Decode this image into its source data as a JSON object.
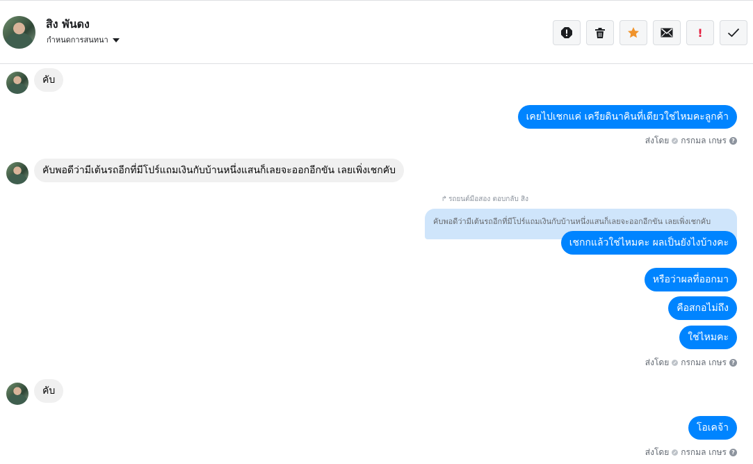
{
  "header": {
    "contact_name": "สิง พันดง",
    "subtitle": "กำหนดการสนทนา",
    "tools": [
      {
        "icon": "alert-circle-icon"
      },
      {
        "icon": "trash-icon"
      },
      {
        "icon": "star-icon",
        "color": "#f0932b"
      },
      {
        "icon": "envelope-icon"
      },
      {
        "icon": "exclamation-icon",
        "label": "!",
        "color": "#e41e3f"
      },
      {
        "icon": "check-icon"
      }
    ]
  },
  "messages": [
    {
      "side": "in",
      "text": "คับ"
    },
    {
      "side": "out",
      "text": "เคยไปเชกแค่ เครียดินาคินที่เดียวใช่ไหมคะลูกค้า"
    },
    {
      "side": "meta",
      "sent_by": "ส่งโดย",
      "sender": "กรกมล เกษร"
    },
    {
      "side": "in",
      "text": "คับพอดีว่ามีเต้นรถอีกที่มีโปร์แถมเงินกับบ้านหนึ่งแสนก็เลยจะออกอีกขัน เลยเพิ่งเชกคับ"
    },
    {
      "side": "reply",
      "note": "รถยนต์มือสอง ตอบกลับ สิง",
      "quote": "คับพอดีว่ามีเต้นรถอีกที่มีโปร์แถมเงินกับบ้านหนึ่งแสนก็เลยจะออกอีกขัน เลยเพิ่งเชกคับ"
    },
    {
      "side": "out",
      "text": "เชกกแล้วใช่ไหมคะ ผลเป็นยังไงบ้างคะ"
    },
    {
      "side": "out",
      "text": "หรือว่าผลที่ออกมา"
    },
    {
      "side": "out",
      "text": "คือสกอไม่ถึง"
    },
    {
      "side": "out",
      "text": "ใช่ไหมคะ"
    },
    {
      "side": "meta",
      "sent_by": "ส่งโดย",
      "sender": "กรกมล เกษร"
    },
    {
      "side": "in",
      "text": "คับ"
    },
    {
      "side": "out",
      "text": "โอเคจ้า"
    },
    {
      "side": "meta",
      "sent_by": "ส่งโดย",
      "sender": "กรกมล เกษร"
    }
  ],
  "colors": {
    "outgoing_bubble": "#0084ff",
    "incoming_bubble": "#f0f0f0",
    "reply_quote": "#cfe5fb"
  }
}
